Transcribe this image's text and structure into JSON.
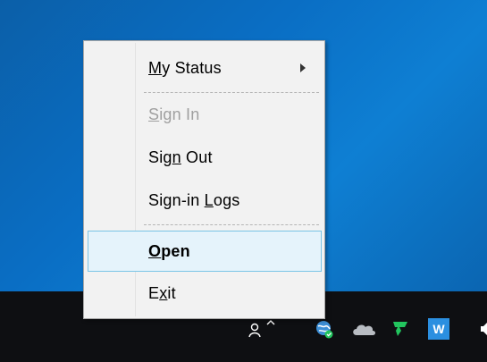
{
  "menu": {
    "items": [
      {
        "pre": "",
        "ul": "M",
        "post": "y Status",
        "state": "normal",
        "submenu": true
      },
      {
        "pre": "",
        "ul": "S",
        "post": "ign In",
        "state": "disabled",
        "submenu": false
      },
      {
        "pre": "Sig",
        "ul": "n",
        "post": " Out",
        "state": "normal",
        "submenu": false
      },
      {
        "pre": "Sign-in ",
        "ul": "L",
        "post": "ogs",
        "state": "normal",
        "submenu": false
      },
      {
        "pre": "",
        "ul": "O",
        "post": "pen",
        "state": "highlighted",
        "submenu": false
      },
      {
        "pre": "E",
        "ul": "x",
        "post": "it",
        "state": "normal",
        "submenu": false
      }
    ]
  },
  "tray": {
    "icons": [
      "people-icon",
      "chevron-up-icon",
      "globe-icon",
      "cloud-icon",
      "shield-icon",
      "w-app-icon",
      "speaker-icon"
    ],
    "w_app_letter": "W"
  },
  "colors": {
    "desktop": "#0a6ec4",
    "taskbar": "#0e0f12",
    "menu_bg": "#f2f2f2",
    "highlight_bg": "#e5f3fb",
    "highlight_border": "#7ac4e6",
    "disabled_text": "#a0a0a0",
    "shield_green": "#22c55e"
  }
}
